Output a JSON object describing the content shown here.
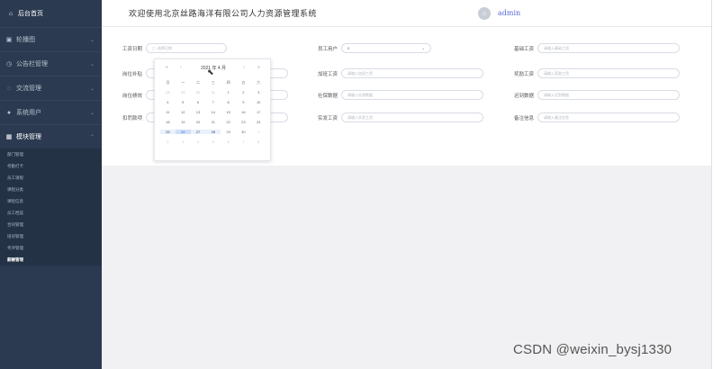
{
  "sidebar": {
    "home": "后台首页",
    "menus": [
      {
        "label": "轮播图",
        "icon": "image-icon"
      },
      {
        "label": "公告栏管理",
        "icon": "clock-icon"
      },
      {
        "label": "交流管理",
        "icon": "chat-icon"
      },
      {
        "label": "系统用户",
        "icon": "user-icon"
      },
      {
        "label": "模块管理",
        "icon": "grid-icon"
      }
    ],
    "sub_items": [
      "部门管理",
      "考勤打卡",
      "员工请假",
      "课程分类",
      "课程信息",
      "员工档案",
      "合同管理",
      "培训管理",
      "考评管理",
      "薪酬管理"
    ],
    "active_sub": "薪酬管理"
  },
  "header": {
    "title": "欢迎使用北京丝路海洋有限公司人力资源管理系统",
    "user": "admin"
  },
  "form": {
    "salary_date": {
      "label": "工资日期",
      "placeholder": "选择日期"
    },
    "post_allowance": {
      "label": "岗位补贴",
      "placeholder": ""
    },
    "post_performance": {
      "label": "岗位绩效",
      "placeholder": ""
    },
    "deduction": {
      "label": "扣罚款项",
      "placeholder": ""
    },
    "employee_user": {
      "label": "员工用户",
      "value": "0"
    },
    "overtime_pay": {
      "label": "加班工资",
      "placeholder": "请输入加班工资"
    },
    "social_security": {
      "label": "社保数据",
      "placeholder": "请输入社保数据"
    },
    "actual_pay": {
      "label": "实发工资",
      "placeholder": "请输入实发工资"
    },
    "base_salary": {
      "label": "基础工资",
      "placeholder": "请输入基础工资"
    },
    "bonus_salary": {
      "label": "奖励工资",
      "placeholder": "请输入奖励工资"
    },
    "late_count": {
      "label": "迟到数据",
      "placeholder": "请输入迟到数据"
    },
    "remark": {
      "label": "备注信息",
      "placeholder": "请输入备注信息"
    }
  },
  "calendar": {
    "title": "2021 年 4 月",
    "weekdays": [
      "日",
      "一",
      "二",
      "三",
      "四",
      "五",
      "六"
    ],
    "weeks": [
      [
        "28",
        "29",
        "30",
        "31",
        "1",
        "2",
        "3"
      ],
      [
        "4",
        "5",
        "6",
        "7",
        "8",
        "9",
        "10"
      ],
      [
        "11",
        "12",
        "13",
        "14",
        "15",
        "16",
        "17"
      ],
      [
        "18",
        "19",
        "20",
        "21",
        "22",
        "23",
        "24"
      ],
      [
        "25",
        "26",
        "27",
        "28",
        "29",
        "30",
        "1"
      ],
      [
        "2",
        "3",
        "4",
        "5",
        "6",
        "7",
        "8"
      ]
    ]
  },
  "watermark": "CSDN @weixin_bysj1330"
}
